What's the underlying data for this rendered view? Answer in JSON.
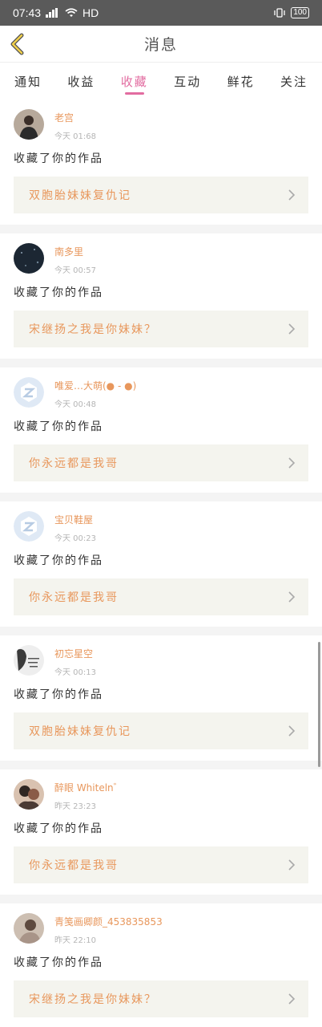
{
  "status_bar": {
    "time": "07:43",
    "network": "HD",
    "battery": "100"
  },
  "header": {
    "title": "消息"
  },
  "tabs": [
    {
      "label": "通知",
      "active": false
    },
    {
      "label": "收益",
      "active": false
    },
    {
      "label": "收藏",
      "active": true
    },
    {
      "label": "互动",
      "active": false
    },
    {
      "label": "鲜花",
      "active": false
    },
    {
      "label": "关注",
      "active": false
    }
  ],
  "colors": {
    "accent": "#e26ca0",
    "name": "#e8975c",
    "work_bg": "#f4f4ee"
  },
  "items": [
    {
      "user": "老宫",
      "time": "今天 01:68",
      "action": "收藏了你的作品",
      "work": "双胞胎妹妹复仇记",
      "avatar": "photo-dark-person"
    },
    {
      "user": "南多里",
      "time": "今天 00:57",
      "action": "收藏了你的作品",
      "work": "宋继扬之我是你妹妹？",
      "avatar": "photo-night-sky"
    },
    {
      "user": "唯爱…大萌(● - ●)",
      "time": "今天 00:48",
      "action": "收藏了你的作品",
      "work": "你永远都是我哥",
      "avatar": "default-avatar"
    },
    {
      "user": "宝贝鞋屋",
      "time": "今天 00:23",
      "action": "收藏了你的作品",
      "work": "你永远都是我哥",
      "avatar": "default-avatar"
    },
    {
      "user": "初忘星空",
      "time": "今天 00:13",
      "action": "收藏了你的作品",
      "work": "双胞胎妹妹复仇记",
      "avatar": "photo-text-girl"
    },
    {
      "user": "醉眼 Whiteln゛",
      "time": "昨天 23:23",
      "action": "收藏了你的作品",
      "work": "你永远都是我哥",
      "avatar": "photo-couple"
    },
    {
      "user": "青笺画卿颜_453835853",
      "time": "昨天 22:10",
      "action": "收藏了你的作品",
      "work": "宋继扬之我是你妹妹？",
      "avatar": "photo-girl"
    }
  ]
}
